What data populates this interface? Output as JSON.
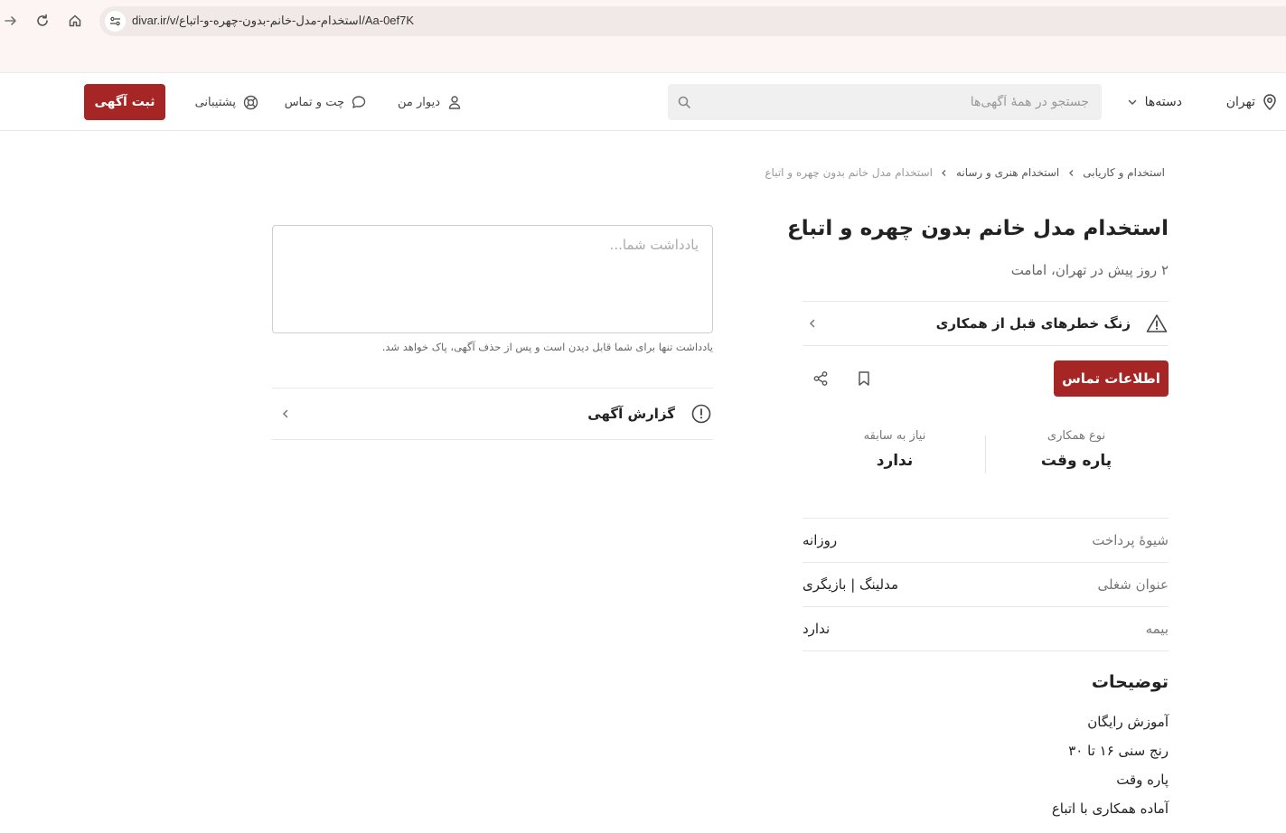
{
  "browser": {
    "url": "divar.ir/v/استخدام-مدل-خانم-بدون-چهره-و-اتباع/Aa-0ef7K"
  },
  "header": {
    "city_label": "تهران",
    "categories_label": "دسته‌ها",
    "search_placeholder": "جستجو در همهٔ آگهی‌ها",
    "my_divar_label": "دیوار من",
    "chat_label": "چت و تماس",
    "support_label": "پشتیبانی",
    "post_ad_label": "ثبت آگهی",
    "accent_color": "#a62626"
  },
  "breadcrumb": {
    "items": [
      "استخدام و کاریابی",
      "استخدام هنری و رسانه",
      "استخدام مدل خانم بدون چهره و اتباع"
    ]
  },
  "ad": {
    "title": "استخدام مدل خانم بدون چهره و اتباع",
    "subtitle": "۲ روز پیش در تهران، امامت",
    "alert_label": "زنگ خطرهای قبل از همکاری",
    "contact_button": "اطلاعات تماس",
    "info": [
      {
        "label": "نوع همکاری",
        "value": "پاره وقت"
      },
      {
        "label": "نیاز به سابقه",
        "value": "ندارد"
      }
    ],
    "attributes": [
      {
        "key": "شیوهٔ پرداخت",
        "value": "روزانه"
      },
      {
        "key": "عنوان شغلی",
        "value": "مدلینگ | بازیگری"
      },
      {
        "key": "بیمه",
        "value": "ندارد"
      }
    ],
    "description_title": "توضیحات",
    "description_lines": [
      "آموزش رایگان",
      "رنج سنی ۱۶ تا ۳۰",
      "پاره وقت",
      "آماده همکاری با اتباع"
    ]
  },
  "note": {
    "placeholder": "یادداشت شما...",
    "hint": "یادداشت تنها برای شما قابل دیدن است و پس از حذف آگهی، پاک خواهد شد."
  },
  "report": {
    "label": "گزارش آگهی"
  }
}
